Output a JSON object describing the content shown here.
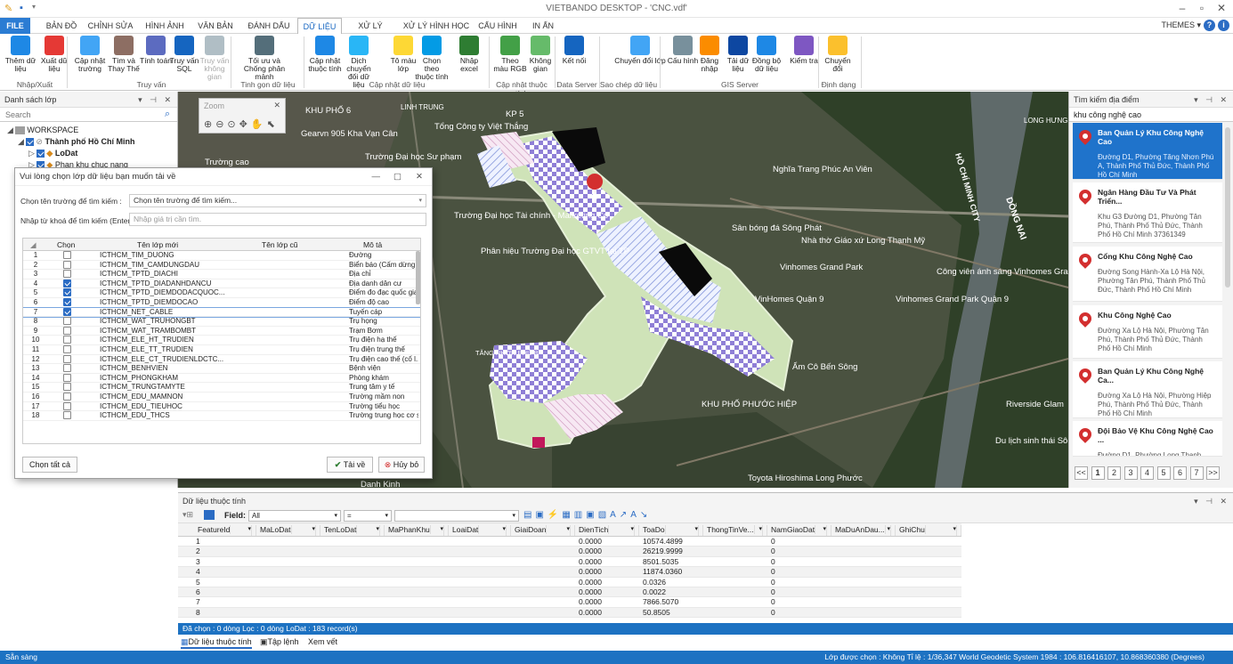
{
  "app": {
    "title": "VIETBANDO DESKTOP - 'CNC.vdf'",
    "themes": "THEMES"
  },
  "menu": {
    "tabs": [
      "FILE",
      "BẢN ĐỒ",
      "CHỈNH SỬA",
      "HÌNH ẢNH",
      "VĂN BẢN",
      "ĐÁNH DẤU",
      "DỮ LIỆU",
      "XỬ LÝ TOPO",
      "XỬ LÝ HÌNH HỌC",
      "CẤU HÌNH",
      "IN ẤN"
    ],
    "active": "DỮ LIỆU"
  },
  "ribbon": {
    "buttons": [
      {
        "label": "Thêm dữ liệu",
        "icon": "add-data-icon",
        "color": "#1e88e5"
      },
      {
        "label": "Xuất dữ liệu",
        "icon": "export-data-icon",
        "color": "#e53935"
      },
      {
        "label": "Cập nhật trường",
        "icon": "update-field-icon",
        "color": "#42a5f5"
      },
      {
        "label": "Tìm và Thay Thế",
        "icon": "find-replace-icon",
        "color": "#8d6e63"
      },
      {
        "label": "Tính toán",
        "icon": "calculate-icon",
        "color": "#5c6bc0"
      },
      {
        "label": "Truy vấn SQL",
        "icon": "sql-icon",
        "color": "#1565c0"
      },
      {
        "label": "Truy vấn không gian",
        "icon": "spatial-query-icon",
        "color": "#b0bec5",
        "disabled": true
      },
      {
        "label": "Tối ưu và Chống phân mảnh",
        "icon": "optimize-icon",
        "color": "#546e7a"
      },
      {
        "label": "Cập nhật thuộc tính",
        "icon": "update-attribute-icon",
        "color": "#1e88e5"
      },
      {
        "label": "Dịch chuyển đối dữ liệu",
        "icon": "move-data-icon",
        "color": "#29b6f6"
      },
      {
        "label": "Tô màu lớp",
        "icon": "color-layer-icon",
        "color": "#fdd835"
      },
      {
        "label": "Chọn theo thuộc tính",
        "icon": "select-attribute-icon",
        "color": "#039be5"
      },
      {
        "label": "Nhập excel",
        "icon": "excel-icon",
        "color": "#2e7d32"
      },
      {
        "label": "Theo màu RGB",
        "icon": "rgb-color-icon",
        "color": "#43a047"
      },
      {
        "label": "Không gian",
        "icon": "space-icon",
        "color": "#66bb6a"
      },
      {
        "label": "Kết nối",
        "icon": "connect-icon",
        "color": "#1565c0"
      },
      {
        "label": "Chuyển đổi lớp",
        "icon": "convert-layer-icon",
        "color": "#42a5f5"
      },
      {
        "label": "Cấu hình",
        "icon": "config-icon",
        "color": "#78909c"
      },
      {
        "label": "Đăng nhập",
        "icon": "login-icon",
        "color": "#fb8c00"
      },
      {
        "label": "Tải dữ liệu",
        "icon": "cloud-download-icon",
        "color": "#0d47a1"
      },
      {
        "label": "Đồng bộ dữ liệu",
        "icon": "cloud-sync-icon",
        "color": "#1e88e5"
      },
      {
        "label": "Kiểm tra",
        "icon": "check-icon",
        "color": "#7e57c2"
      },
      {
        "label": "Chuyển đổi",
        "icon": "convert-format-icon",
        "color": "#fbc02d"
      }
    ],
    "groups": [
      "Nhập/Xuất",
      "Truy vấn",
      "Tinh gọn dữ liệu",
      "Cập nhật dữ liệu",
      "Cập nhật thuộc tính",
      "Data Server",
      "Sao chép dữ liệu",
      "GIS Server",
      "Định dạng"
    ]
  },
  "left_panel": {
    "title": "Danh sách lớp",
    "search_placeholder": "Search",
    "tree": [
      {
        "label": "WORKSPACE",
        "level": 0,
        "checked": null
      },
      {
        "label": "Thành phố Hồ Chí Minh",
        "level": 1,
        "checked": true
      },
      {
        "label": "LoDat",
        "level": 2,
        "checked": true
      },
      {
        "label": "Phan khu chuc nang",
        "level": 2,
        "checked": true
      }
    ]
  },
  "map": {
    "zoom_title": "Zoom",
    "labels": [
      "KHU PHỐ 6",
      "LINH TRUNG",
      "KP 5",
      "Gearvn 905 Kha Vạn Cân",
      "Trường cao",
      "Tổng Công ty Việt Thắng",
      "Trường Đại học Sư phạm",
      "Trường Đại học Tài chính - Marketing Cơ",
      "Phân hiệu Trường Đại học GTVT tại TP",
      "Nghĩa Trang Phúc An Viên",
      "Sân bóng đá Sông Phát",
      "Nhà thờ Giáo xứ Long Thạnh Mỹ",
      "Vinhomes Grand Park",
      "Công viên ánh sáng Vinhomes Grandpark",
      "VinHomes Quận 9",
      "Vinhomes Grand Park Quận 9",
      "Ẩm Cô Bến Sông",
      "KHU PHỐ PHƯỚC HIỆP",
      "TĂNG NHƠN PHÚ B",
      "Riverside Glam",
      "Du lịch sinh thái Sông Gia",
      "Toyota Hiroshima Long Phước",
      "DỒNG NAI",
      "HỒ CHÍ MINH CITY",
      "LONG HƯNG",
      "Danh Kinh"
    ]
  },
  "right_panel": {
    "title": "Tìm kiếm địa điểm",
    "query": "khu công nghệ cao",
    "results": [
      {
        "name": "Ban Quản Lý Khu Công Nghệ Cao",
        "address": "Đường D1, Phường Tăng Nhơn Phú A, Thành Phố Thủ Đức, Thành Phố Hồ Chí Minh",
        "selected": true
      },
      {
        "name": "Ngân Hàng Đầu Tư Và Phát Triển...",
        "address": "Khu G3 Đường D1, Phường Tân Phú, Thành Phố Thủ Đức, Thành Phố Hồ Chí Minh 37361349",
        "selected": false
      },
      {
        "name": "Cổng Khu Công Nghệ Cao",
        "address": "Đường Song Hành-Xa Lộ Hà Nội, Phường Tân Phú, Thành Phố Thủ Đức, Thành Phố Hồ Chí Minh",
        "selected": false
      },
      {
        "name": "Khu Công Nghệ Cao",
        "address": "Đường Xa Lộ Hà Nội, Phường Tân Phú, Thành Phố Thủ Đức, Thành Phố Hồ Chí Minh",
        "selected": false
      },
      {
        "name": "Ban Quản Lý Khu Công Nghệ Ca...",
        "address": "Đường Xa Lộ Hà Nội, Phường Hiệp Phú, Thành Phố Thủ Đức, Thành Phố Hồ Chí Minh",
        "selected": false
      },
      {
        "name": "Đội Bảo Vệ Khu Công Nghệ Cao ...",
        "address": "Đường D1, Phường Long Thạnh",
        "selected": false
      }
    ],
    "pages": [
      "<<",
      "1",
      "2",
      "3",
      "4",
      "5",
      "6",
      "7",
      ">>"
    ]
  },
  "dialog": {
    "title": "Vui lòng chọn lớp dữ liệu bạn muốn tải về",
    "field_label": "Chọn tên trường để tìm kiếm :",
    "field_value": "Chọn tên trường để tìm kiếm...",
    "keyword_label": "Nhập từ khoá để tìm kiếm (Enter) :",
    "keyword_placeholder": "Nhập giá trị cần tìm.",
    "columns": [
      "Chọn",
      "Tên lớp mới",
      "Tên lớp cũ",
      "Mô tả"
    ],
    "rows": [
      {
        "n": "1",
        "checked": false,
        "name": "ICTHCM_TIM_DUONG",
        "old": "",
        "desc": "Đường"
      },
      {
        "n": "2",
        "checked": false,
        "name": "ICTHCM_TIM_CAMDUNGDAU",
        "old": "",
        "desc": "Biển báo (Cấm dừng..."
      },
      {
        "n": "3",
        "checked": false,
        "name": "ICTHCM_TPTD_DIACHI",
        "old": "",
        "desc": "Địa chỉ"
      },
      {
        "n": "4",
        "checked": true,
        "name": "ICTHCM_TPTD_DIADANHDANCU",
        "old": "",
        "desc": "Địa danh dân cư"
      },
      {
        "n": "5",
        "checked": true,
        "name": "ICTHCM_TPTD_DIEMDODACQUOC...",
        "old": "",
        "desc": "Điểm đo đạc quốc gia"
      },
      {
        "n": "6",
        "checked": true,
        "name": "ICTHCM_TPTD_DIEMDOCAO",
        "old": "",
        "desc": "Điểm độ cao"
      },
      {
        "n": "7",
        "checked": true,
        "name": "ICTHCM_NET_CABLE",
        "old": "",
        "desc": "Tuyến cáp"
      },
      {
        "n": "8",
        "checked": false,
        "name": "ICTHCM_WAT_TRUHONGBT",
        "old": "",
        "desc": "Trụ họng"
      },
      {
        "n": "9",
        "checked": false,
        "name": "ICTHCM_WAT_TRAMBOMBT",
        "old": "",
        "desc": "Trạm Bơm"
      },
      {
        "n": "10",
        "checked": false,
        "name": "ICTHCM_ELE_HT_TRUDIEN",
        "old": "",
        "desc": "Trụ điện hạ thế"
      },
      {
        "n": "11",
        "checked": false,
        "name": "ICTHCM_ELE_TT_TRUDIEN",
        "old": "",
        "desc": "Trụ điện trung thế"
      },
      {
        "n": "12",
        "checked": false,
        "name": "ICTHCM_ELE_CT_TRUDIENLDCTC...",
        "old": "",
        "desc": "Trụ điện cao thế (cố l..."
      },
      {
        "n": "13",
        "checked": false,
        "name": "ICTHCM_BENHVIEN",
        "old": "",
        "desc": "Bệnh viện"
      },
      {
        "n": "14",
        "checked": false,
        "name": "ICTHCM_PHONGKHAM",
        "old": "",
        "desc": "Phòng khám"
      },
      {
        "n": "15",
        "checked": false,
        "name": "ICTHCM_TRUNGTAMYTE",
        "old": "",
        "desc": "Trung tâm y tế"
      },
      {
        "n": "16",
        "checked": false,
        "name": "ICTHCM_EDU_MAMNON",
        "old": "",
        "desc": "Trường mầm non"
      },
      {
        "n": "17",
        "checked": false,
        "name": "ICTHCM_EDU_TIEUHOC",
        "old": "",
        "desc": "Trường tiểu học"
      },
      {
        "n": "18",
        "checked": false,
        "name": "ICTHCM_EDU_THCS",
        "old": "",
        "desc": "Trường trung học cơ sở"
      }
    ],
    "select_all": "Chọn tất cả",
    "download": "Tải về",
    "cancel": "Hủy bỏ"
  },
  "attributes": {
    "title": "Dữ liệu thuộc tính",
    "field_label": "Field:",
    "field_value": "All",
    "operator": "=",
    "columns": [
      "FeatureId",
      "MaLoDat",
      "TenLoDat",
      "MaPhanKhu",
      "LoaiDat",
      "GiaiDoan",
      "DienTich",
      "ToaDo",
      "ThongTinVe...",
      "NamGiaoDat",
      "MaDuAnDau...",
      "GhiChu"
    ],
    "rows": [
      {
        "id": "1",
        "dientich": "0.0000",
        "toado": "10574.4899",
        "nam": "0"
      },
      {
        "id": "2",
        "dientich": "0.0000",
        "toado": "26219.9999",
        "nam": "0"
      },
      {
        "id": "3",
        "dientich": "0.0000",
        "toado": "8501.5035",
        "nam": "0"
      },
      {
        "id": "4",
        "dientich": "0.0000",
        "toado": "11874.0360",
        "nam": "0"
      },
      {
        "id": "5",
        "dientich": "0.0000",
        "toado": "0.0326",
        "nam": "0"
      },
      {
        "id": "6",
        "dientich": "0.0000",
        "toado": "0.0022",
        "nam": "0"
      },
      {
        "id": "7",
        "dientich": "0.0000",
        "toado": "7866.5070",
        "nam": "0"
      },
      {
        "id": "8",
        "dientich": "0.0000",
        "toado": "50.8505",
        "nam": "0"
      }
    ],
    "selection_status": "Đã chọn : 0 dòng   Lọc : 0 dòng   LoDat : 183 record(s)",
    "tabs": [
      "Dữ liệu thuộc tính",
      "Tập lệnh",
      "Xem vết"
    ]
  },
  "status": {
    "left": "Sẵn sàng",
    "right": "Lớp được chọn : Không  Tỉ lệ : 1/36,347      World Geodetic System 1984 : 106.816416107, 10.868360380 (Degrees)"
  }
}
